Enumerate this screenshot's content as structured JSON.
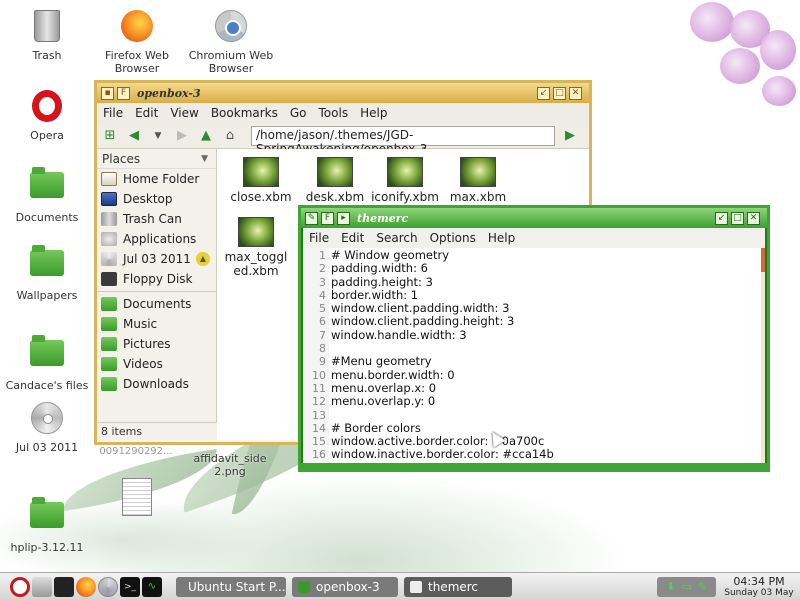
{
  "desktop": {
    "icons": [
      {
        "label": "Trash"
      },
      {
        "label": "Firefox Web Browser"
      },
      {
        "label": "Chromium Web Browser"
      },
      {
        "label": "Opera"
      },
      {
        "label": "Documents"
      },
      {
        "label": "Wallpapers"
      },
      {
        "label": "Candace's files"
      },
      {
        "label": "Jul 03 2011"
      },
      {
        "label": "hplip-3.12.11"
      },
      {
        "label": "affidavit_side 2.png"
      },
      {
        "label": "0091290292..."
      }
    ]
  },
  "file_manager": {
    "title": "openbox-3",
    "menu": [
      "File",
      "Edit",
      "View",
      "Bookmarks",
      "Go",
      "Tools",
      "Help"
    ],
    "path": "/home/jason/.themes/JGD-SpringAwakening/openbox-3",
    "places_label": "Places",
    "places": [
      "Home Folder",
      "Desktop",
      "Trash Can",
      "Applications",
      "Jul 03 2011",
      "Floppy Disk"
    ],
    "bookmarks": [
      "Documents",
      "Music",
      "Pictures",
      "Videos",
      "Downloads"
    ],
    "status": "8 items",
    "files": [
      "close.xbm",
      "desk.xbm",
      "iconify.xbm",
      "max.xbm",
      "max_toggled.xbm"
    ]
  },
  "editor": {
    "title": "themerc",
    "menu": [
      "File",
      "Edit",
      "Search",
      "Options",
      "Help"
    ],
    "lines": [
      "# Window geometry",
      "padding.width: 6",
      "padding.height: 3",
      "border.width: 1",
      "window.client.padding.width: 3",
      "window.client.padding.height: 3",
      "window.handle.width: 3",
      "",
      "#Menu geometry",
      "menu.border.width: 0",
      "menu.overlap.x: 0",
      "menu.overlap.y: 0",
      "",
      "# Border colors",
      "window.active.border.color: #0a700c",
      "window.inactive.border.color: #cca14b"
    ],
    "line_numbers": [
      "1",
      "2",
      "3",
      "4",
      "5",
      "6",
      "7",
      "8",
      "9",
      "10",
      "11",
      "12",
      "13",
      "14",
      "15",
      "16"
    ]
  },
  "panel": {
    "tasks": [
      "Ubuntu Start P...",
      "openbox-3",
      "themerc"
    ],
    "clock_time": "04:34 PM",
    "clock_date": "Sunday 03 May"
  },
  "colors": {
    "fm_border": "#d7b55a",
    "editor_border": "#3fa534",
    "folder_green": "#3b9b2a"
  }
}
